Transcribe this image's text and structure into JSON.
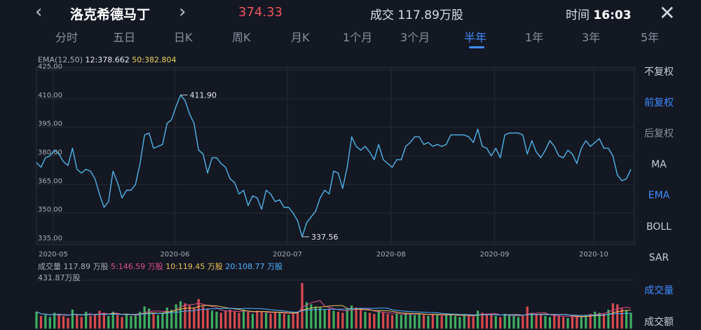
{
  "header": {
    "back_icon": "chevron-left-icon",
    "forward_icon": "chevron-right-icon",
    "stock_name": "洛克希德马丁",
    "price": "374.33",
    "volume_label": "成交 117.89万股",
    "time_prefix": "时间",
    "time_value": "16:03",
    "close_icon": "close-icon",
    "price_color": "#e8555c"
  },
  "tabs": [
    {
      "label": "分时"
    },
    {
      "label": "五日"
    },
    {
      "label": "日K"
    },
    {
      "label": "周K"
    },
    {
      "label": "月K"
    },
    {
      "label": "1个月"
    },
    {
      "label": "3个月"
    },
    {
      "label": "半年"
    },
    {
      "label": "1年"
    },
    {
      "label": "3年"
    },
    {
      "label": "5年"
    }
  ],
  "active_tab": "半年",
  "accent_color": "#3f8cff",
  "ema_legend": {
    "prefix": "EMA(12,50)",
    "ema12_label": "12:",
    "ema12_value": "378.662",
    "ema50_label": "50:",
    "ema50_value": "382.804"
  },
  "volume_legend": {
    "label": "成交量",
    "value": "117.89 万股",
    "ma5_label": "5:",
    "ma5_value": "146.59 万股",
    "ma10_label": "10:",
    "ma10_value": "119.45 万股",
    "ma20_label": "20:",
    "ma20_value": "108.77 万股",
    "max_label": "431.87万股"
  },
  "side_panel": {
    "items": [
      "不复权",
      "前复权",
      "后复权",
      "MA",
      "EMA",
      "BOLL",
      "SAR",
      "成交量",
      "成交额"
    ]
  },
  "chart_data": {
    "type": "line",
    "title": "",
    "xlabel": "",
    "ylabel": "",
    "ylim": [
      335,
      425
    ],
    "y_ticks": [
      "425.00",
      "410.00",
      "395.00",
      "380.00",
      "365.00",
      "350.00",
      "335.00"
    ],
    "x_ticks": [
      "2020-05",
      "2020-06",
      "2020-07",
      "2020-08",
      "2020-09",
      "2020-10"
    ],
    "peak_label": "411.90",
    "trough_label": "337.56",
    "line_color": "#4fb3e8",
    "values": [
      376.5,
      374,
      379,
      380,
      383,
      381,
      377,
      375,
      384,
      373,
      371,
      373,
      372,
      368,
      360,
      353,
      356,
      372,
      366,
      358,
      362,
      362,
      365,
      376,
      391,
      392,
      384,
      385,
      386,
      397,
      399,
      406,
      411.9,
      409,
      402,
      397,
      383,
      381,
      371,
      379,
      379,
      376,
      374,
      368,
      366,
      360,
      362,
      354,
      359,
      358,
      352,
      362,
      360,
      356,
      357,
      353,
      353,
      350,
      346,
      337.56,
      345,
      348,
      351,
      358,
      362,
      360,
      372,
      371,
      363,
      374,
      390,
      385,
      383,
      385,
      382,
      378,
      386,
      378,
      376,
      374,
      378,
      378,
      385,
      387,
      390,
      390,
      386,
      387,
      385,
      386,
      385,
      386,
      391,
      391,
      391,
      391,
      390,
      387,
      394,
      385,
      384,
      380,
      384,
      379,
      391,
      392,
      392,
      392,
      391,
      381,
      388,
      382,
      379,
      383,
      388,
      385,
      380,
      379,
      383,
      381,
      376,
      384,
      388,
      385,
      387,
      389,
      384,
      384,
      380,
      370,
      367,
      368,
      373
    ],
    "volumes": [
      160,
      120,
      130,
      110,
      150,
      140,
      120,
      100,
      180,
      130,
      110,
      160,
      120,
      130,
      170,
      150,
      120,
      160,
      130,
      110,
      140,
      120,
      130,
      160,
      210,
      190,
      140,
      130,
      150,
      200,
      180,
      230,
      260,
      240,
      220,
      200,
      280,
      210,
      190,
      170,
      160,
      150,
      170,
      180,
      160,
      150,
      180,
      160,
      140,
      170,
      160,
      150,
      140,
      160,
      150,
      140,
      130,
      150,
      160,
      431.87,
      250,
      230,
      210,
      200,
      180,
      190,
      170,
      160,
      150,
      180,
      220,
      200,
      180,
      160,
      150,
      140,
      170,
      150,
      140,
      130,
      140,
      130,
      150,
      140,
      130,
      140,
      130,
      120,
      140,
      130,
      120,
      130,
      140,
      120,
      110,
      130,
      120,
      110,
      170,
      150,
      140,
      130,
      120,
      110,
      140,
      130,
      120,
      110,
      120,
      210,
      150,
      140,
      130,
      120,
      110,
      130,
      120,
      110,
      100,
      110,
      120,
      110,
      130,
      140,
      160,
      150,
      140,
      180,
      240,
      230,
      190,
      170,
      150
    ]
  }
}
